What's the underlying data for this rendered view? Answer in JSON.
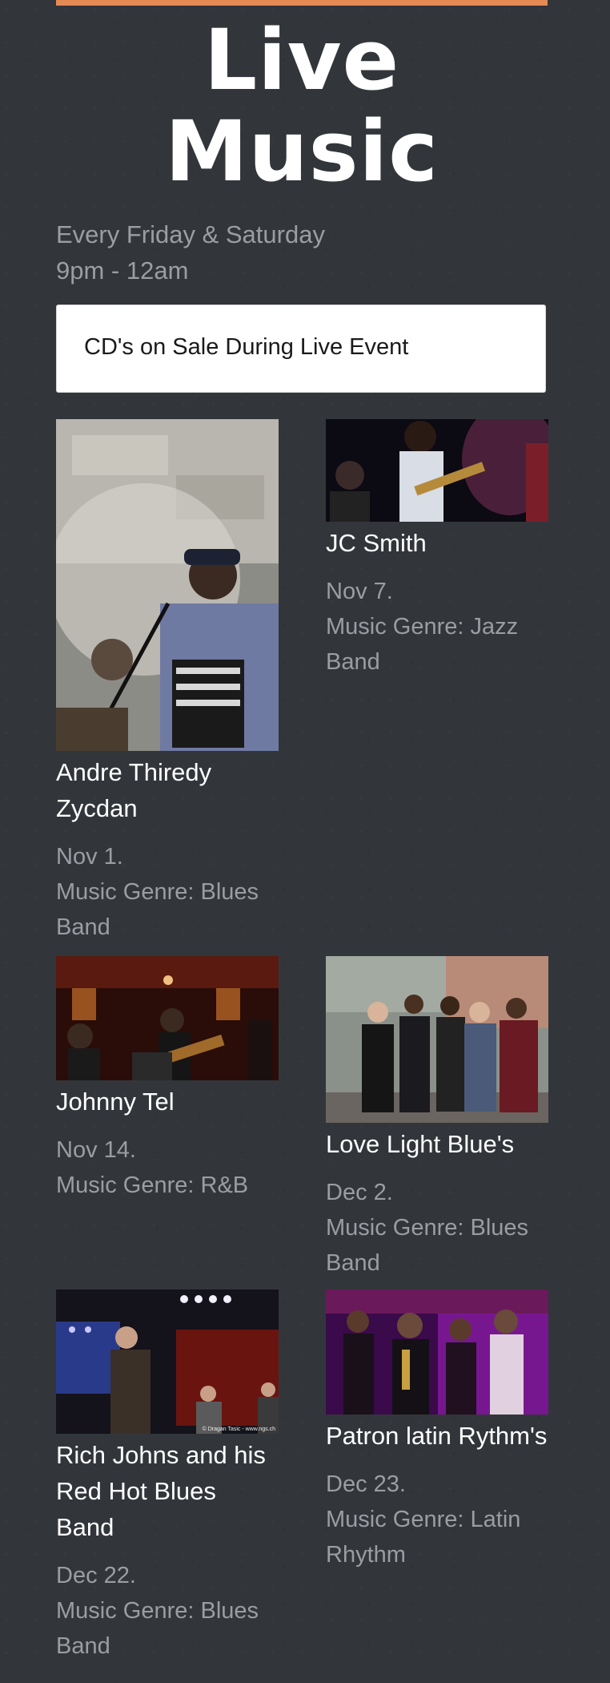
{
  "header": {
    "title_line1": "Live",
    "title_line2": "Music",
    "schedule_days": "Every Friday & Saturday",
    "schedule_hours": "9pm - 12am",
    "notice": "CD's on Sale During Live Event"
  },
  "colors": {
    "background": "#32363b",
    "accent": "#e58a55",
    "muted_text": "#9a9ea3"
  },
  "events": [
    {
      "name": "Andre Thiredy Zycdan",
      "date": "Nov 1.",
      "genre": "Music Genre: Blues Band",
      "photo": "accordion-singer-photo"
    },
    {
      "name": "JC Smith",
      "date": "Nov 7.",
      "genre": "Music Genre: Jazz Band",
      "photo": "guitarist-stage-photo"
    },
    {
      "name": "Johnny Tel",
      "date": "Nov 14.",
      "genre": "Music Genre: R&B",
      "photo": "band-bar-photo"
    },
    {
      "name": "Love Light Blue's",
      "date": "Dec 2.",
      "genre": "Music Genre: Blues Band",
      "photo": "group-portrait-photo"
    },
    {
      "name": "Rich Johns and his Red Hot Blues Band",
      "date": "Dec 22.",
      "genre": "Music Genre: Blues Band",
      "photo": "harmonica-stage-photo"
    },
    {
      "name": "Patron latin Rythm's",
      "date": "Dec 23.",
      "genre": "Music Genre: Latin Rhythm",
      "photo": "latin-band-photo"
    }
  ],
  "photo_watermark": "© Dragan Tasic - www.ngs.ch"
}
